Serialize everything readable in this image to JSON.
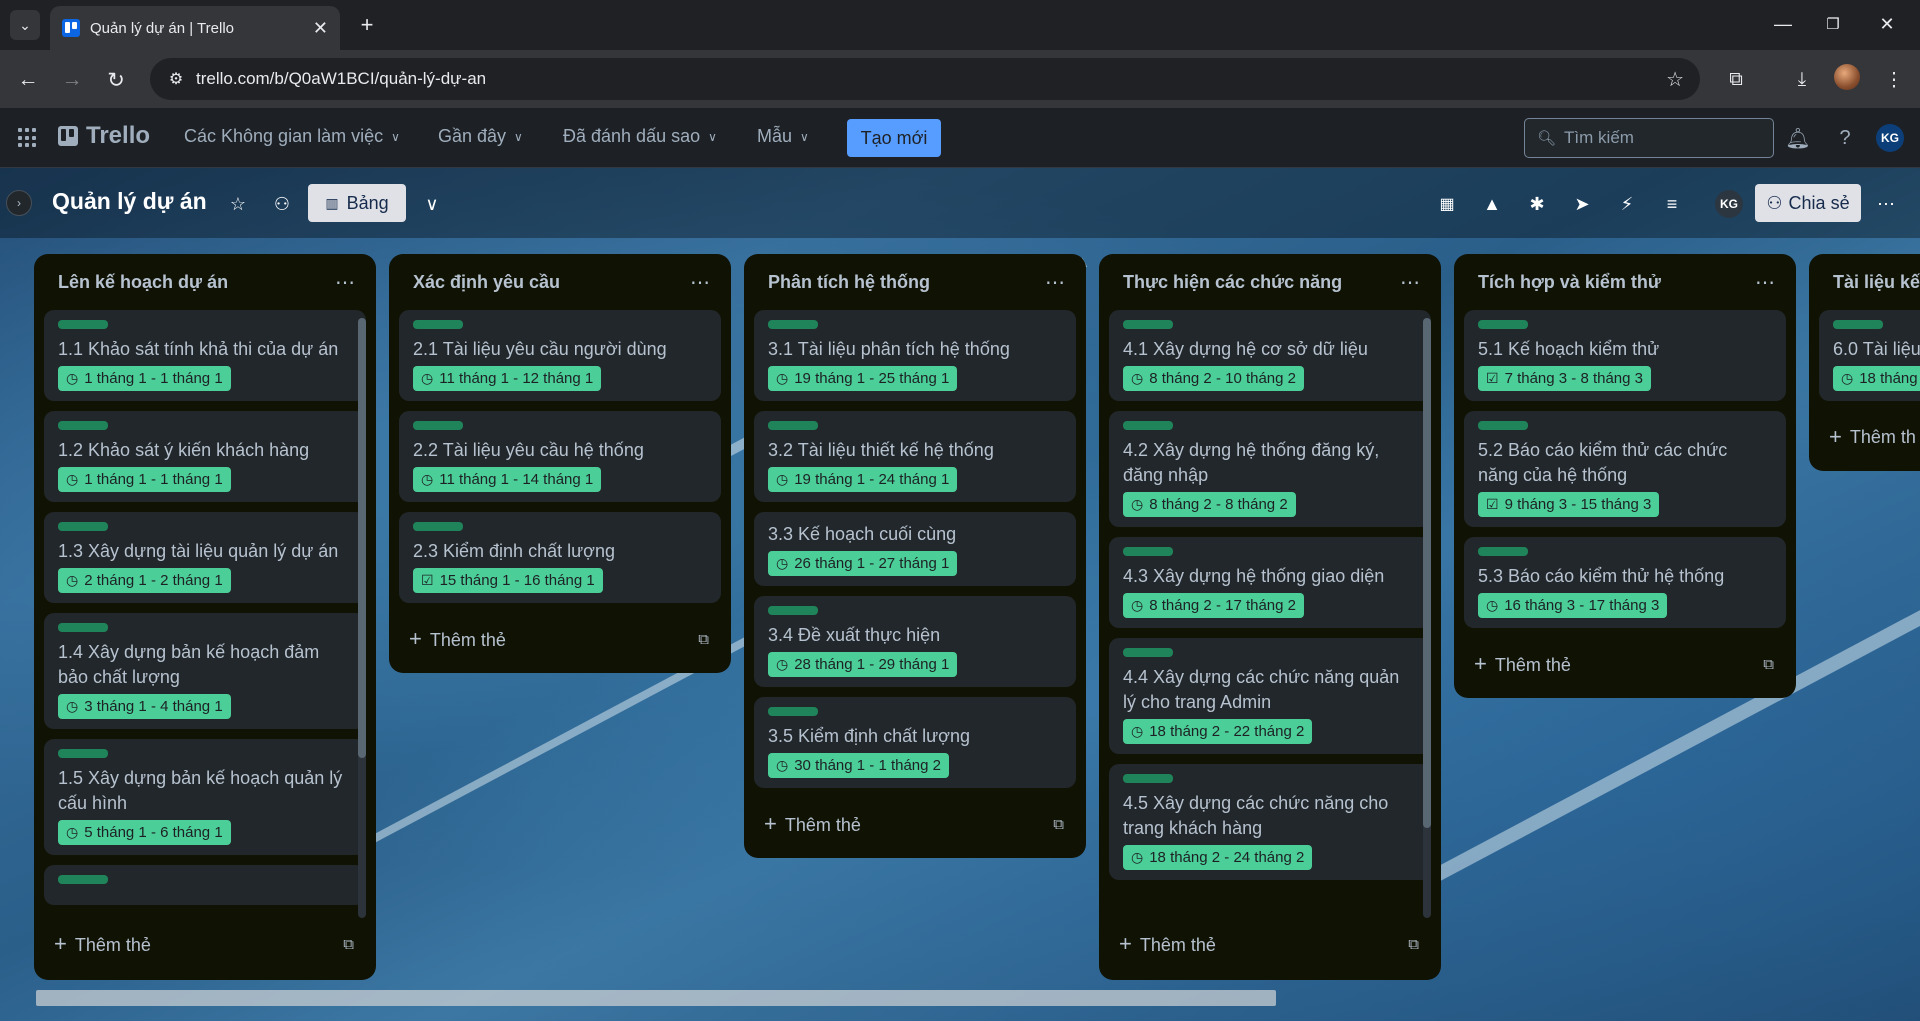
{
  "browser": {
    "tab_title": "Quản lý dự án | Trello",
    "url": "trello.com/b/Q0aW1BCI/quản-lý-dự-an"
  },
  "header": {
    "logo_text": "Trello",
    "menus": [
      "Các Không gian làm việc",
      "Gần đây",
      "Đã đánh dấu sao",
      "Mẫu"
    ],
    "create_label": "Tạo mới",
    "search_placeholder": "Tìm kiếm",
    "avatar_initials": "KG"
  },
  "board": {
    "title": "Quản lý dự án",
    "view_label": "Bảng",
    "share_label": "Chia sẻ",
    "member_initials": "KG"
  },
  "lists": [
    {
      "title": "Lên kế hoạch dự án",
      "cards": [
        {
          "title": "1.1 Khảo sát tính khả thi của dự án",
          "date": "1 tháng 1 - 1 tháng 1",
          "done": false
        },
        {
          "title": "1.2 Khảo sát ý kiến khách hàng",
          "date": "1 tháng 1 - 1 tháng 1",
          "done": false
        },
        {
          "title": "1.3 Xây dựng tài liệu quản lý dự án",
          "date": "2 tháng 1 - 2 tháng 1",
          "done": false
        },
        {
          "title": "1.4 Xây dựng bản kế hoạch đảm bảo chất lượng",
          "date": "3 tháng 1 - 4 tháng 1",
          "done": false
        },
        {
          "title": "1.5 Xây dựng bản kế hoạch quản lý cấu hình",
          "date": "5 tháng 1 - 6 tháng 1",
          "done": false
        }
      ],
      "add_label": "Thêm thẻ"
    },
    {
      "title": "Xác định yêu cầu",
      "cards": [
        {
          "title": "2.1 Tài liệu yêu cầu người dùng",
          "date": "11 tháng 1 - 12 tháng 1",
          "done": false
        },
        {
          "title": "2.2 Tài liệu yêu cầu hệ thống",
          "date": "11 tháng 1 - 14 tháng 1",
          "done": false
        },
        {
          "title": "2.3 Kiểm định chất lượng",
          "date": "15 tháng 1 - 16 tháng 1",
          "done": true
        }
      ],
      "add_label": "Thêm thẻ"
    },
    {
      "title": "Phân tích hệ thống",
      "cards": [
        {
          "title": "3.1 Tài liệu phân tích hệ thống",
          "date": "19 tháng 1 - 25 tháng 1",
          "done": false
        },
        {
          "title": "3.2 Tài liệu thiết kế hệ thống",
          "date": "19 tháng 1 - 24 tháng 1",
          "done": false
        },
        {
          "title": "3.3 Kế hoạch cuối cùng",
          "date": "26 tháng 1 - 27 tháng 1",
          "done": false
        },
        {
          "title": "3.4 Đề xuất thực hiện",
          "date": "28 tháng 1 - 29 tháng 1",
          "done": false
        },
        {
          "title": "3.5 Kiểm định chất lượng",
          "date": "30 tháng 1 - 1 tháng 2",
          "done": false
        }
      ],
      "add_label": "Thêm thẻ"
    },
    {
      "title": "Thực hiện các chức năng",
      "cards": [
        {
          "title": "4.1 Xây dựng hệ cơ sở dữ liệu",
          "date": "8 tháng 2 - 10 tháng 2",
          "done": false
        },
        {
          "title": "4.2 Xây dựng hệ thống đăng ký, đăng nhập",
          "date": "8 tháng 2 - 8 tháng 2",
          "done": false
        },
        {
          "title": "4.3 Xây dựng hệ thống giao diện",
          "date": "8 tháng 2 - 17 tháng 2",
          "done": false
        },
        {
          "title": "4.4 Xây dựng các chức năng quản lý cho trang Admin",
          "date": "18 tháng 2 - 22 tháng 2",
          "done": false
        },
        {
          "title": "4.5 Xây dựng các chức năng cho trang khách hàng",
          "date": "18 tháng 2 - 24 tháng 2",
          "done": false
        }
      ],
      "add_label": "Thêm thẻ"
    },
    {
      "title": "Tích hợp và kiểm thử",
      "cards": [
        {
          "title": "5.1 Kế hoạch kiểm thử",
          "date": "7 tháng 3 - 8 tháng 3",
          "done": true
        },
        {
          "title": "5.2 Báo cáo kiểm thử các chức năng của hệ thống",
          "date": "9 tháng 3 - 15 tháng 3",
          "done": true
        },
        {
          "title": "5.3 Báo cáo kiểm thử hệ thống",
          "date": "16 tháng 3 - 17 tháng 3",
          "done": false
        }
      ],
      "add_label": "Thêm thẻ"
    },
    {
      "title": "Tài liệu kết",
      "cards": [
        {
          "title": "6.0 Tài liệu",
          "date": "18 tháng",
          "done": false
        }
      ],
      "add_label": "Thêm th"
    }
  ]
}
